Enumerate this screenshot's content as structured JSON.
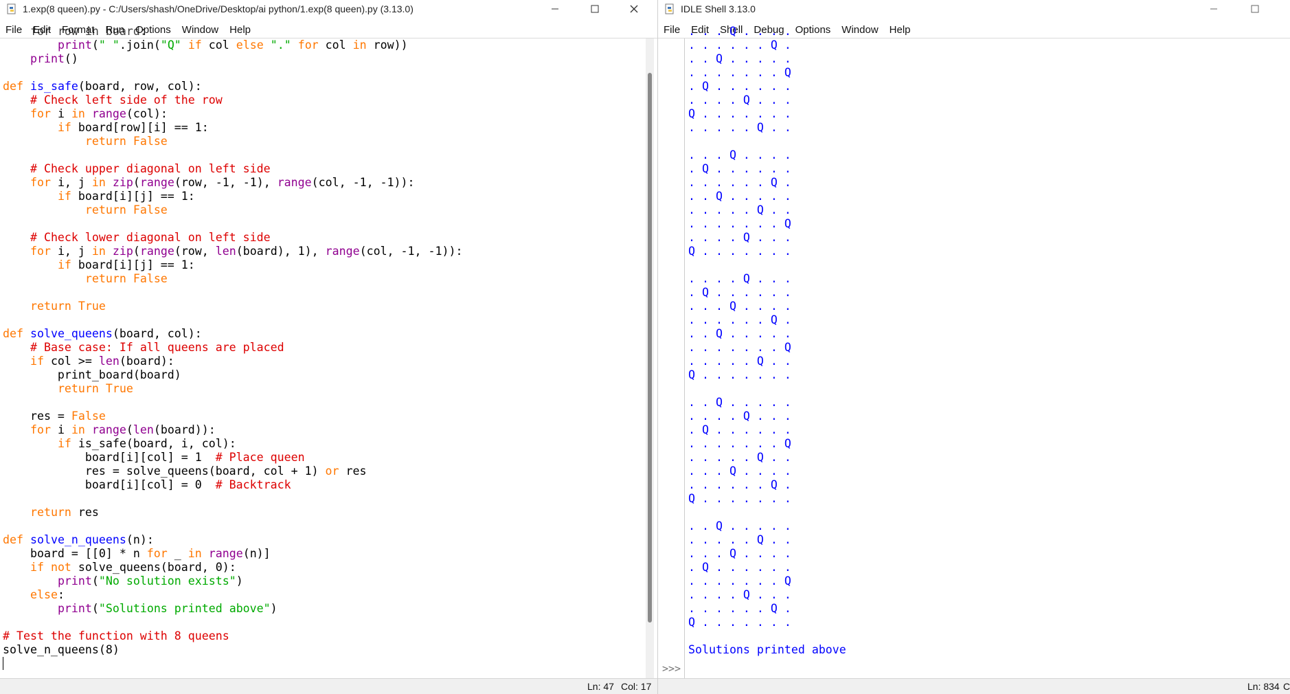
{
  "editor": {
    "title": "1.exp(8 queen).py - C:/Users/shash/OneDrive/Desktop/ai python/1.exp(8 queen).py (3.13.0)",
    "menu": [
      "File",
      "Edit",
      "Format",
      "Run",
      "Options",
      "Window",
      "Help"
    ],
    "status": {
      "line": "Ln: 47",
      "col": "Col: 17"
    },
    "code_lines": [
      [
        [
          "    for row in board:",
          ""
        ]
      ],
      [
        [
          "        ",
          ""
        ],
        [
          "print",
          "bi"
        ],
        [
          "(",
          ""
        ],
        [
          "\" \"",
          "st"
        ],
        [
          ".join(",
          ""
        ],
        [
          "\"Q\"",
          "st"
        ],
        [
          " ",
          ""
        ],
        [
          "if",
          "kw"
        ],
        [
          " col ",
          ""
        ],
        [
          "else",
          "kw"
        ],
        [
          " ",
          ""
        ],
        [
          "\".\"",
          "st"
        ],
        [
          " ",
          ""
        ],
        [
          "for",
          "kw"
        ],
        [
          " col ",
          ""
        ],
        [
          "in",
          "kw"
        ],
        [
          " row))",
          ""
        ]
      ],
      [
        [
          "    ",
          ""
        ],
        [
          "print",
          "bi"
        ],
        [
          "()",
          ""
        ]
      ],
      [
        [
          "",
          ""
        ]
      ],
      [
        [
          "def",
          "kw"
        ],
        [
          " ",
          ""
        ],
        [
          "is_safe",
          "df"
        ],
        [
          "(board, row, col):",
          ""
        ]
      ],
      [
        [
          "    ",
          ""
        ],
        [
          "# Check left side of the row",
          "cm"
        ]
      ],
      [
        [
          "    ",
          ""
        ],
        [
          "for",
          "kw"
        ],
        [
          " i ",
          ""
        ],
        [
          "in",
          "kw"
        ],
        [
          " ",
          ""
        ],
        [
          "range",
          "bi"
        ],
        [
          "(col):",
          ""
        ]
      ],
      [
        [
          "        ",
          ""
        ],
        [
          "if",
          "kw"
        ],
        [
          " board[row][i] == 1:",
          ""
        ]
      ],
      [
        [
          "            ",
          ""
        ],
        [
          "return",
          "kw"
        ],
        [
          " ",
          ""
        ],
        [
          "False",
          "kw"
        ]
      ],
      [
        [
          "",
          ""
        ]
      ],
      [
        [
          "    ",
          ""
        ],
        [
          "# Check upper diagonal on left side",
          "cm"
        ]
      ],
      [
        [
          "    ",
          ""
        ],
        [
          "for",
          "kw"
        ],
        [
          " i, j ",
          ""
        ],
        [
          "in",
          "kw"
        ],
        [
          " ",
          ""
        ],
        [
          "zip",
          "bi"
        ],
        [
          "(",
          ""
        ],
        [
          "range",
          "bi"
        ],
        [
          "(row, -1, -1), ",
          ""
        ],
        [
          "range",
          "bi"
        ],
        [
          "(col, -1, -1)):",
          ""
        ]
      ],
      [
        [
          "        ",
          ""
        ],
        [
          "if",
          "kw"
        ],
        [
          " board[i][j] == 1:",
          ""
        ]
      ],
      [
        [
          "            ",
          ""
        ],
        [
          "return",
          "kw"
        ],
        [
          " ",
          ""
        ],
        [
          "False",
          "kw"
        ]
      ],
      [
        [
          "",
          ""
        ]
      ],
      [
        [
          "    ",
          ""
        ],
        [
          "# Check lower diagonal on left side",
          "cm"
        ]
      ],
      [
        [
          "    ",
          ""
        ],
        [
          "for",
          "kw"
        ],
        [
          " i, j ",
          ""
        ],
        [
          "in",
          "kw"
        ],
        [
          " ",
          ""
        ],
        [
          "zip",
          "bi"
        ],
        [
          "(",
          ""
        ],
        [
          "range",
          "bi"
        ],
        [
          "(row, ",
          ""
        ],
        [
          "len",
          "bi"
        ],
        [
          "(board), 1), ",
          ""
        ],
        [
          "range",
          "bi"
        ],
        [
          "(col, -1, -1)):",
          ""
        ]
      ],
      [
        [
          "        ",
          ""
        ],
        [
          "if",
          "kw"
        ],
        [
          " board[i][j] == 1:",
          ""
        ]
      ],
      [
        [
          "            ",
          ""
        ],
        [
          "return",
          "kw"
        ],
        [
          " ",
          ""
        ],
        [
          "False",
          "kw"
        ]
      ],
      [
        [
          "",
          ""
        ]
      ],
      [
        [
          "    ",
          ""
        ],
        [
          "return",
          "kw"
        ],
        [
          " ",
          ""
        ],
        [
          "True",
          "kw"
        ]
      ],
      [
        [
          "",
          ""
        ]
      ],
      [
        [
          "def",
          "kw"
        ],
        [
          " ",
          ""
        ],
        [
          "solve_queens",
          "df"
        ],
        [
          "(board, col):",
          ""
        ]
      ],
      [
        [
          "    ",
          ""
        ],
        [
          "# Base case: If all queens are placed",
          "cm"
        ]
      ],
      [
        [
          "    ",
          ""
        ],
        [
          "if",
          "kw"
        ],
        [
          " col >= ",
          ""
        ],
        [
          "len",
          "bi"
        ],
        [
          "(board):",
          ""
        ]
      ],
      [
        [
          "        print_board(board)",
          ""
        ]
      ],
      [
        [
          "        ",
          ""
        ],
        [
          "return",
          "kw"
        ],
        [
          " ",
          ""
        ],
        [
          "True",
          "kw"
        ]
      ],
      [
        [
          "",
          ""
        ]
      ],
      [
        [
          "    res = ",
          ""
        ],
        [
          "False",
          "kw"
        ]
      ],
      [
        [
          "    ",
          ""
        ],
        [
          "for",
          "kw"
        ],
        [
          " i ",
          ""
        ],
        [
          "in",
          "kw"
        ],
        [
          " ",
          ""
        ],
        [
          "range",
          "bi"
        ],
        [
          "(",
          ""
        ],
        [
          "len",
          "bi"
        ],
        [
          "(board)):",
          ""
        ]
      ],
      [
        [
          "        ",
          ""
        ],
        [
          "if",
          "kw"
        ],
        [
          " is_safe(board, i, col):",
          ""
        ]
      ],
      [
        [
          "            board[i][col] = 1  ",
          ""
        ],
        [
          "# Place queen",
          "cm"
        ]
      ],
      [
        [
          "            res = solve_queens(board, col + 1) ",
          ""
        ],
        [
          "or",
          "kw"
        ],
        [
          " res",
          ""
        ]
      ],
      [
        [
          "            board[i][col] = 0  ",
          ""
        ],
        [
          "# Backtrack",
          "cm"
        ]
      ],
      [
        [
          "",
          ""
        ]
      ],
      [
        [
          "    ",
          ""
        ],
        [
          "return",
          "kw"
        ],
        [
          " res",
          ""
        ]
      ],
      [
        [
          "",
          ""
        ]
      ],
      [
        [
          "def",
          "kw"
        ],
        [
          " ",
          ""
        ],
        [
          "solve_n_queens",
          "df"
        ],
        [
          "(n):",
          ""
        ]
      ],
      [
        [
          "    board = [[0] * n ",
          ""
        ],
        [
          "for",
          "kw"
        ],
        [
          " _ ",
          ""
        ],
        [
          "in",
          "kw"
        ],
        [
          " ",
          ""
        ],
        [
          "range",
          "bi"
        ],
        [
          "(n)]",
          ""
        ]
      ],
      [
        [
          "    ",
          ""
        ],
        [
          "if",
          "kw"
        ],
        [
          " ",
          ""
        ],
        [
          "not",
          "kw"
        ],
        [
          " solve_queens(board, 0):",
          ""
        ]
      ],
      [
        [
          "        ",
          ""
        ],
        [
          "print",
          "bi"
        ],
        [
          "(",
          ""
        ],
        [
          "\"No solution exists\"",
          "st"
        ],
        [
          ")",
          ""
        ]
      ],
      [
        [
          "    ",
          ""
        ],
        [
          "else",
          "kw"
        ],
        [
          ":",
          ""
        ]
      ],
      [
        [
          "        ",
          ""
        ],
        [
          "print",
          "bi"
        ],
        [
          "(",
          ""
        ],
        [
          "\"Solutions printed above\"",
          "st"
        ],
        [
          ")",
          ""
        ]
      ],
      [
        [
          "",
          ""
        ]
      ],
      [
        [
          "# Test the function with 8 queens",
          "cm"
        ]
      ],
      [
        [
          "solve_n_queens(8)",
          ""
        ]
      ]
    ]
  },
  "shell": {
    "title": "IDLE Shell 3.13.0",
    "menu": [
      "File",
      "Edit",
      "Shell",
      "Debug",
      "Options",
      "Window",
      "Help"
    ],
    "status": {
      "line": "Ln: 834",
      "col": "C"
    },
    "output_lines": [
      ". . . Q . . . .",
      ". . . . . . Q .",
      ". . Q . . . . .",
      ". . . . . . . Q",
      ". Q . . . . . .",
      ". . . . Q . . .",
      "Q . . . . . . .",
      ". . . . . Q . .",
      "",
      ". . . Q . . . .",
      ". Q . . . . . .",
      ". . . . . . Q .",
      ". . Q . . . . .",
      ". . . . . Q . .",
      ". . . . . . . Q",
      ". . . . Q . . .",
      "Q . . . . . . .",
      "",
      ". . . . Q . . .",
      ". Q . . . . . .",
      ". . . Q . . . .",
      ". . . . . . Q .",
      ". . Q . . . . .",
      ". . . . . . . Q",
      ". . . . . Q . .",
      "Q . . . . . . .",
      "",
      ". . Q . . . . .",
      ". . . . Q . . .",
      ". Q . . . . . .",
      ". . . . . . . Q",
      ". . . . . Q . .",
      ". . . Q . . . .",
      ". . . . . . Q .",
      "Q . . . . . . .",
      "",
      ". . Q . . . . .",
      ". . . . . Q . .",
      ". . . Q . . . .",
      ". Q . . . . . .",
      ". . . . . . . Q",
      ". . . . Q . . .",
      ". . . . . . Q .",
      "Q . . . . . . .",
      "",
      "Solutions printed above"
    ],
    "prompt": ">>>"
  },
  "colors": {
    "keyword": "#ff7700",
    "builtin": "#900090",
    "string": "#00aa00",
    "comment": "#dd0000",
    "definition": "#0000ff",
    "output": "#0000ff"
  }
}
